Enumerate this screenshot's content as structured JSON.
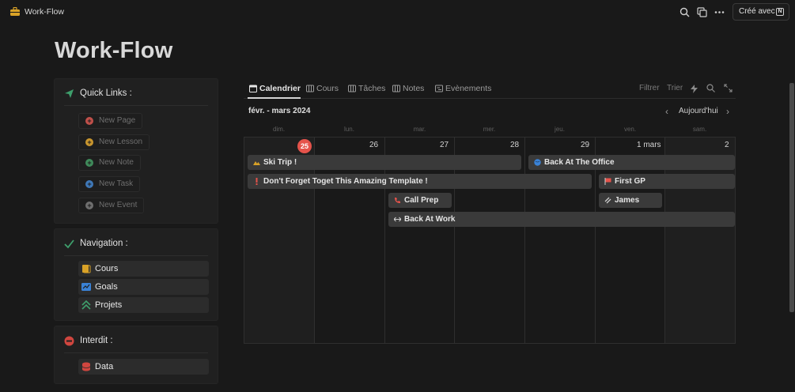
{
  "topbar": {
    "app_title": "Work-Flow",
    "share_label": "Créé avec",
    "share_logo": "N",
    "icons": [
      "briefcase-icon",
      "search-icon",
      "duplicate-icon",
      "more-icon"
    ]
  },
  "page": {
    "title": "Work-Flow"
  },
  "quick_links": {
    "title": "Quick Links :",
    "buttons": [
      {
        "label": "New Page",
        "color": "#c0504a"
      },
      {
        "label": "New Lesson",
        "color": "#c9962e"
      },
      {
        "label": "New Note",
        "color": "#3f8a5a"
      },
      {
        "label": "New Task",
        "color": "#3f78b8"
      },
      {
        "label": "New Event",
        "color": "#6f6f6f"
      }
    ]
  },
  "navigation": {
    "title": "Navigation :",
    "items": [
      {
        "label": "Cours",
        "icon": "book-icon",
        "color": "#d9a227"
      },
      {
        "label": "Goals",
        "icon": "chart-icon",
        "color": "#3a82d6"
      },
      {
        "label": "Projets",
        "icon": "chevrons-up-icon",
        "color": "#3e9f6c"
      }
    ]
  },
  "forbidden": {
    "title": "Interdit :",
    "items": [
      {
        "label": "Data",
        "icon": "database-icon",
        "color": "#d0463f"
      }
    ]
  },
  "views": {
    "tabs": [
      {
        "label": "Calendrier",
        "icon": "calendar-icon"
      },
      {
        "label": "Cours",
        "icon": "table-icon"
      },
      {
        "label": "Tâches",
        "icon": "table-icon"
      },
      {
        "label": "Notes",
        "icon": "table-icon"
      },
      {
        "label": "Evènements",
        "icon": "timeline-icon"
      }
    ],
    "active_tab": "Calendrier",
    "tools": {
      "filter": "Filtrer",
      "sort": "Trier"
    }
  },
  "calendar": {
    "range": "févr. - mars 2024",
    "today_button": "Aujourd'hui",
    "weekdays": [
      "dim.",
      "lun.",
      "mar.",
      "mer.",
      "jeu.",
      "ven.",
      "sam."
    ],
    "days": [
      "25",
      "26",
      "27",
      "28",
      "29",
      "1 mars",
      "2"
    ],
    "today": "25",
    "events": [
      {
        "title": "Ski Trip !",
        "icon": "mountain-icon",
        "color": "#d9a227"
      },
      {
        "title": "Back At The Office",
        "icon": "globe-icon",
        "color": "#3a82d6"
      },
      {
        "title": "Don't Forget Toget This Amazing Template !",
        "icon": "exclamation-icon",
        "color": "#e5534b"
      },
      {
        "title": "First GP",
        "icon": "flag-icon",
        "color": "#e5534b"
      },
      {
        "title": "Call Prep",
        "icon": "phone-icon",
        "color": "#e5534b"
      },
      {
        "title": "James",
        "icon": "link-icon",
        "color": "#cfcfcf"
      },
      {
        "title": "Back At Work",
        "icon": "arrows-icon",
        "color": "#cfcfcf"
      }
    ]
  }
}
